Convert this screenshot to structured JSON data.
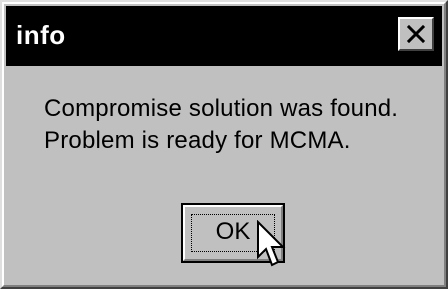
{
  "window": {
    "title": "info"
  },
  "title_bar_controls": {
    "close_icon": "close-icon"
  },
  "message": {
    "line1": "Compromise solution was found.",
    "line2": "Problem is ready for MCMA."
  },
  "buttons": {
    "ok_label": "OK"
  },
  "pointer": {
    "icon": "mouse-pointer-icon"
  },
  "colors": {
    "titlebar": "#000000",
    "title_text": "#ffffff",
    "dialog_bg": "#c0c0c0"
  }
}
